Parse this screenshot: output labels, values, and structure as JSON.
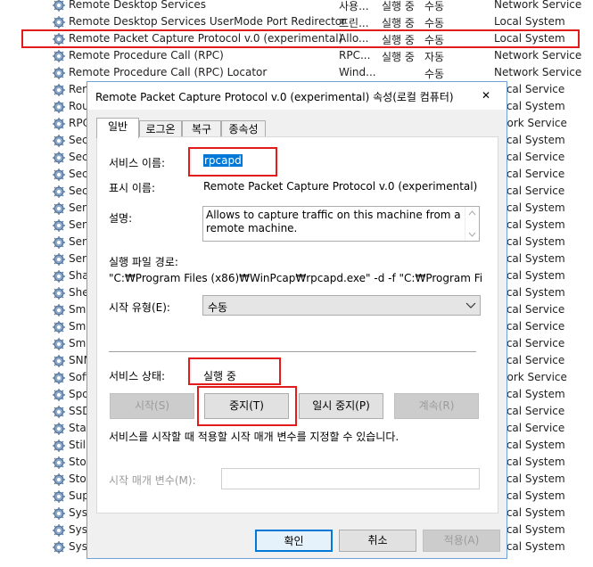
{
  "services": [
    {
      "name": "Remote Desktop Services",
      "desc": "사용...",
      "status": "실행 중",
      "startup": "수동",
      "logon": "Network Service"
    },
    {
      "name": "Remote Desktop Services UserMode Port Redirector",
      "desc": "프린...",
      "status": "실행 중",
      "startup": "수동",
      "logon": "Local System"
    },
    {
      "name": "Remote Packet Capture Protocol v.0 (experimental)",
      "desc": "Allo...",
      "status": "실행 중",
      "startup": "수동",
      "logon": "Local System"
    },
    {
      "name": "Remote Procedure Call (RPC)",
      "desc": "RPC...",
      "status": "실행 중",
      "startup": "자동",
      "logon": "Network Service"
    },
    {
      "name": "Remote Procedure Call (RPC) Locator",
      "desc": "Wind...",
      "status": "",
      "startup": "수동",
      "logon": "Network Service"
    },
    {
      "name": "Rem",
      "logon": "Local Service"
    },
    {
      "name": "Rou",
      "logon": "Local System"
    },
    {
      "name": "RPC",
      "logon": "twork Service"
    },
    {
      "name": "Sec",
      "logon": "Local System"
    },
    {
      "name": "Sec",
      "logon": "Local Service"
    },
    {
      "name": "Sec",
      "logon": "Local Service"
    },
    {
      "name": "Sec",
      "logon": "Local Service"
    },
    {
      "name": "Sen",
      "logon": "Local System"
    },
    {
      "name": "Sen",
      "logon": "Local System"
    },
    {
      "name": "Sen",
      "logon": "Local System"
    },
    {
      "name": "Serv",
      "logon": "Local System"
    },
    {
      "name": "Sha",
      "logon": "Local System"
    },
    {
      "name": "She",
      "logon": "Local System"
    },
    {
      "name": "Sma",
      "logon": "Local Service"
    },
    {
      "name": "Sma",
      "logon": "Local Service"
    },
    {
      "name": "Sma",
      "logon": "Local Service"
    },
    {
      "name": "SNM",
      "logon": "Local Service"
    },
    {
      "name": "Soft",
      "logon": "twork Service"
    },
    {
      "name": "Spo",
      "logon": "Local System"
    },
    {
      "name": "SSD",
      "logon": "Local Service"
    },
    {
      "name": "Stat",
      "logon": "Local Service"
    },
    {
      "name": "Still",
      "logon": "Local System"
    },
    {
      "name": "Stor",
      "logon": "Local System"
    },
    {
      "name": "Stor",
      "logon": "Local System"
    },
    {
      "name": "Sup",
      "logon": "Local System"
    },
    {
      "name": "Syst",
      "logon": "Local System"
    },
    {
      "name": "Syst",
      "logon": "Local System"
    },
    {
      "name": "Syst",
      "logon": "Local System"
    }
  ],
  "dialog": {
    "title": "Remote Packet Capture Protocol v.0 (experimental) 속성(로컬 컴퓨터)",
    "close_glyph": "✕",
    "tabs": {
      "general": "일반",
      "logon": "로그온",
      "recovery": "복구",
      "dependencies": "종속성"
    },
    "service_name_label": "서비스 이름:",
    "service_name_value": "rpcapd",
    "display_name_label": "표시 이름:",
    "display_name_value": "Remote Packet Capture Protocol v.0 (experimental)",
    "description_label": "설명:",
    "description_value": "Allows to capture traffic on this machine from a remote machine.",
    "exe_path_label": "실행 파일 경로:",
    "exe_path_value": "\"C:₩Program Files (x86)₩WinPcap₩rpcapd.exe\" -d -f \"C:₩Program Files (x86",
    "startup_type_label": "시작 유형(E):",
    "startup_type_value": "수동",
    "status_label": "서비스 상태:",
    "status_value": "실행 중",
    "buttons": {
      "start": "시작(S)",
      "stop": "중지(T)",
      "pause": "일시 중지(P)",
      "resume": "계속(R)"
    },
    "hint": "서비스를 시작할 때 적용할 시작 매개 변수를 지정할 수 있습니다.",
    "params_label": "시작 매개 변수(M):",
    "footer": {
      "ok": "확인",
      "cancel": "취소",
      "apply": "적용(A)"
    }
  },
  "colors": {
    "highlight": "#e21b1b",
    "selection": "#0078d7",
    "dialog_border": "#6fa3d6"
  }
}
